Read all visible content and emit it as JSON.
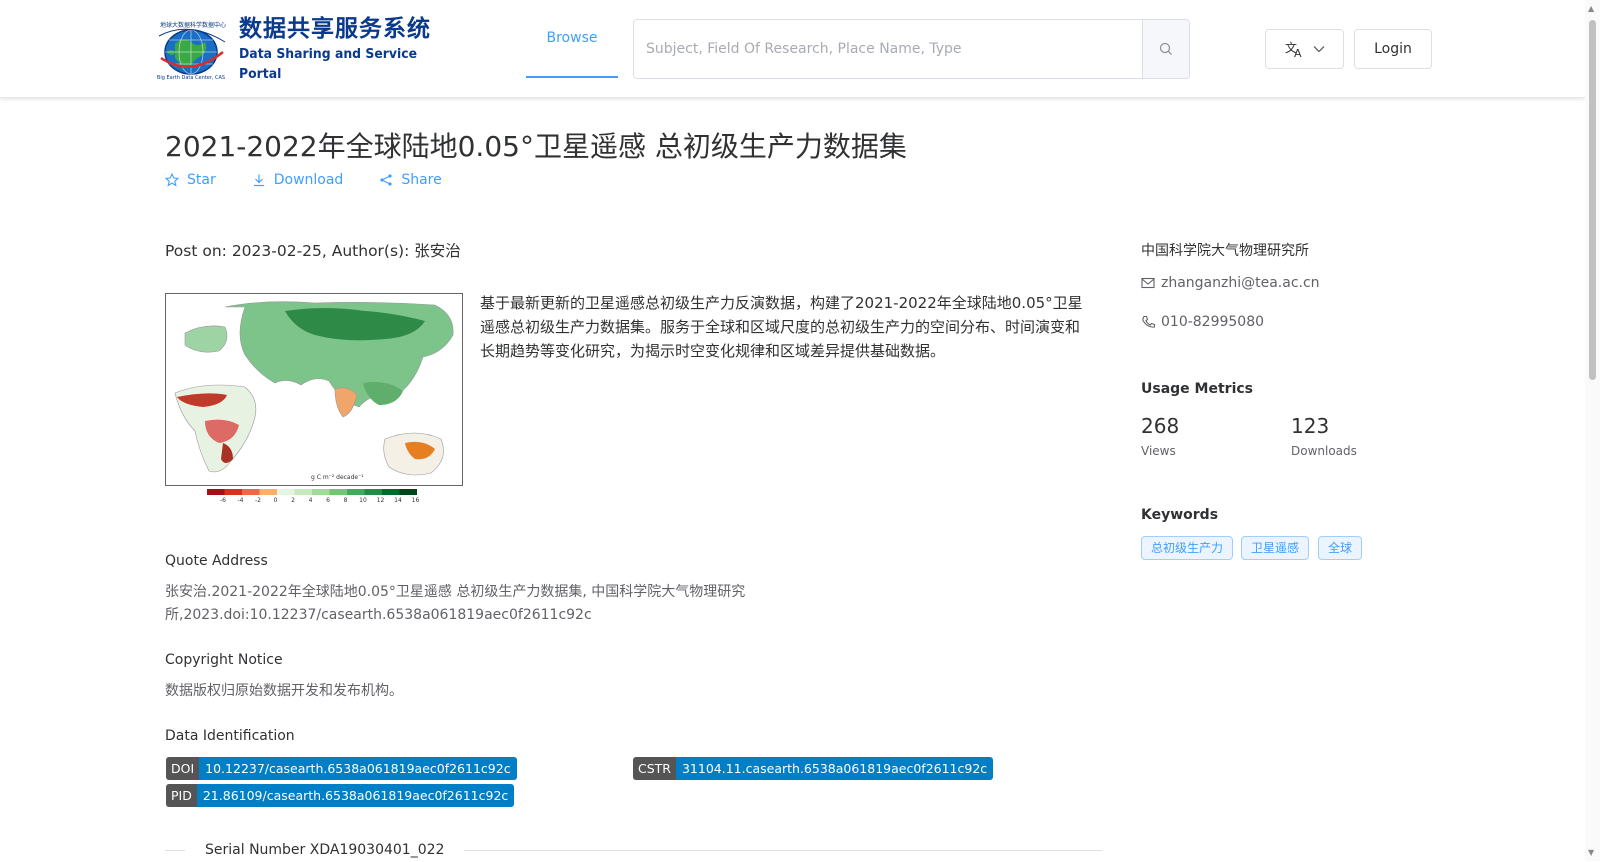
{
  "header": {
    "logo_cn": "数据共享服务系统",
    "logo_en": "Data Sharing and Service Portal",
    "nav_browse": "Browse",
    "search_placeholder": "Subject, Field Of Research, Place Name, Type",
    "login_label": "Login"
  },
  "dataset": {
    "title": "2021-2022年全球陆地0.05°卫星遥感 总初级生产力数据集",
    "actions": {
      "star": "Star",
      "download": "Download",
      "share": "Share"
    },
    "post_on": "Post on: 2023-02-25, Author(s): 张安治",
    "description": "基于最新更新的卫星遥感总初级生产力反演数据，构建了2021-2022年全球陆地0.05°卫星遥感总初级生产力数据集。服务于全球和区域尺度的总初级生产力的空间分布、时间演变和长期趋势等变化研究，为揭示时空变化规律和区域差异提供基础数据。",
    "thumbnail": {
      "unit_label": "g C m⁻² decade⁻¹",
      "legend_ticks": [
        "-6",
        "-4",
        "-2",
        "0",
        "2",
        "4",
        "6",
        "8",
        "10",
        "12",
        "14",
        "16"
      ]
    },
    "quote_title": "Quote Address",
    "quote_text": "张安治.2021-2022年全球陆地0.05°卫星遥感 总初级生产力数据集, 中国科学院大气物理研究所,2023.doi:10.12237/casearth.6538a061819aec0f2611c92c",
    "copyright_title": "Copyright Notice",
    "copyright_text": "数据版权归原始数据开发和发布机构。",
    "identification_title": "Data Identification",
    "ids": {
      "doi_key": "DOI",
      "doi_val": "10.12237/casearth.6538a061819aec0f2611c92c",
      "cstr_key": "CSTR",
      "cstr_val": "31104.11.casearth.6538a061819aec0f2611c92c",
      "pid_key": "PID",
      "pid_val": "21.86109/casearth.6538a061819aec0f2611c92c"
    },
    "serial": "Serial Number XDA19030401_022"
  },
  "sidebar": {
    "org": "中国科学院大气物理研究所",
    "email": "zhanganzhi@tea.ac.cn",
    "phone": "010-82995080",
    "metrics_title": "Usage Metrics",
    "views_num": "268",
    "views_label": "Views",
    "downloads_num": "123",
    "downloads_label": "Downloads",
    "keywords_title": "Keywords",
    "keywords": [
      "总初级生产力",
      "卫星遥感",
      "全球"
    ]
  },
  "colors": {
    "accent": "#409eff",
    "logo_blue": "#0b3a8c",
    "badge_dark": "#555555",
    "badge_blue": "#007ec6"
  }
}
